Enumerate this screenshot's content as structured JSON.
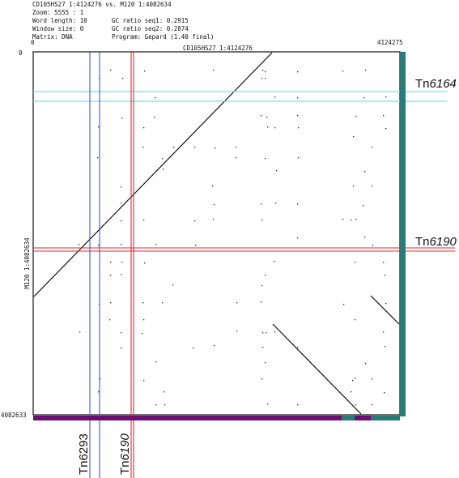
{
  "header": {
    "line1": "CD105HS27 1:4124276 vs. M120 1:4082634",
    "zoom": "Zoom: 5555 : 1",
    "word_length": "Word length: 10",
    "window_size": "Window size: 0",
    "matrix": "Matrix: DNA",
    "gc1": "GC ratio seq1: 0.2915",
    "gc2": "GC ratio seq2: 0.2874",
    "program": "Program: Gepard (1.40 final)"
  },
  "axes": {
    "x_title": "CD105HS27 1:4124276",
    "y_title": "M120 1:4082634",
    "x_start": "0",
    "x_end": "4124275",
    "y_start": "0",
    "y_end": "4082633"
  },
  "annotations": {
    "tn6164_prefix": "Tn",
    "tn6164_num": "6164",
    "tn6190_right_prefix": "Tn",
    "tn6190_right_num": "6190",
    "tn6293_label": "Tn6293",
    "tn6190_bottom_prefix": "Tn",
    "tn6190_bottom_num": "6190"
  },
  "colors": {
    "frame": "#111111",
    "cyan_lines": "#6fe0e6",
    "red_lines": "#e8252b",
    "blue_lines": "#3d5bd6",
    "purple_bar": "#6c0f74",
    "teal_bar": "#2a7a7a"
  }
}
